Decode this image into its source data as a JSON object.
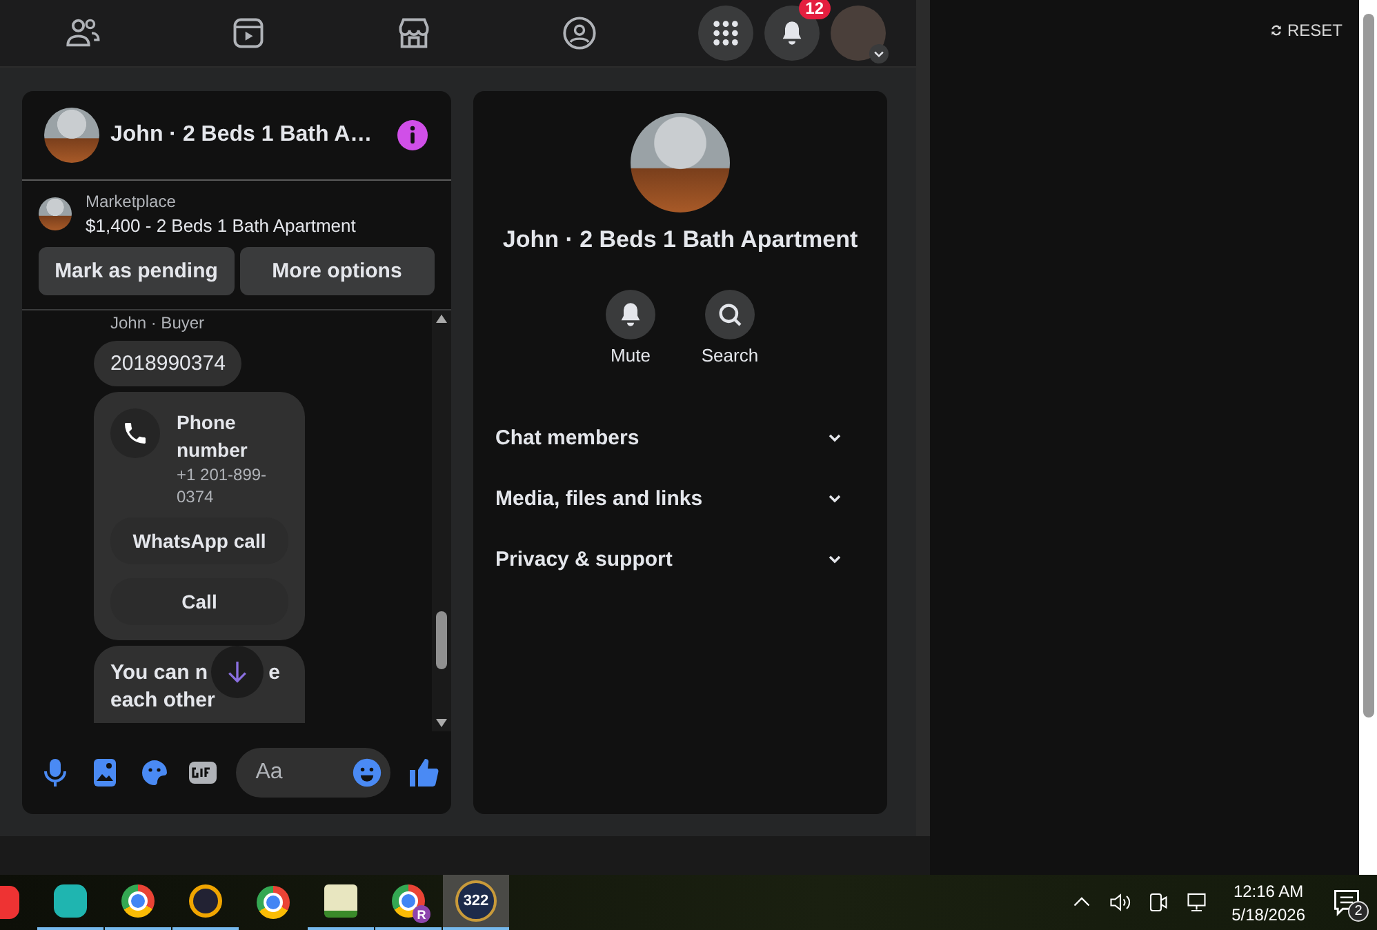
{
  "top_nav": {
    "notification_count": "12"
  },
  "reset": {
    "label": "RESET"
  },
  "chat": {
    "title": "John · 2 Beds 1 Bath A…",
    "listing": {
      "source": "Marketplace",
      "title": "$1,400 - 2 Beds 1 Bath Apartment"
    },
    "actions": [
      "Mark as pending",
      "More options"
    ],
    "messages": [
      {
        "kind": "sender",
        "text": "John · Buyer"
      },
      {
        "kind": "bubble",
        "text": "2018990374"
      },
      {
        "kind": "contact_card",
        "title": "Phone number",
        "detail": "+1 201-899-0374",
        "buttons": [
          "WhatsApp call",
          "Call"
        ]
      },
      {
        "kind": "notice",
        "title_parts": [
          "You can n",
          "e"
        ],
        "title_line2": "each other"
      }
    ],
    "composer": {
      "placeholder": "Aa"
    }
  },
  "info": {
    "name": "John · 2 Beds 1 Bath Apartment",
    "buttons": [
      {
        "kind": "mute",
        "label": "Mute"
      },
      {
        "kind": "search",
        "label": "Search"
      }
    ],
    "sections": [
      {
        "label": "Chat members",
        "expanded": false
      },
      {
        "label": "Media, files and links",
        "expanded": false
      },
      {
        "label": "Privacy & support",
        "expanded": false
      }
    ]
  },
  "taskbar": {
    "apps": [
      {
        "kind": "red",
        "running": false,
        "selected": false
      },
      {
        "kind": "vpn",
        "running": true,
        "selected": false
      },
      {
        "kind": "browser",
        "running": true,
        "selected": false
      },
      {
        "kind": "ix",
        "running": true,
        "selected": false
      },
      {
        "kind": "browser",
        "running": false,
        "selected": false
      },
      {
        "kind": "notes",
        "running": true,
        "selected": false
      },
      {
        "kind": "browser",
        "running": true,
        "selected": false,
        "badge": "R"
      },
      {
        "kind": "calendar",
        "running": true,
        "selected": true,
        "label": "322"
      }
    ],
    "time": "12:16 AM",
    "date": "5/18/2026",
    "notification_count": "2"
  }
}
